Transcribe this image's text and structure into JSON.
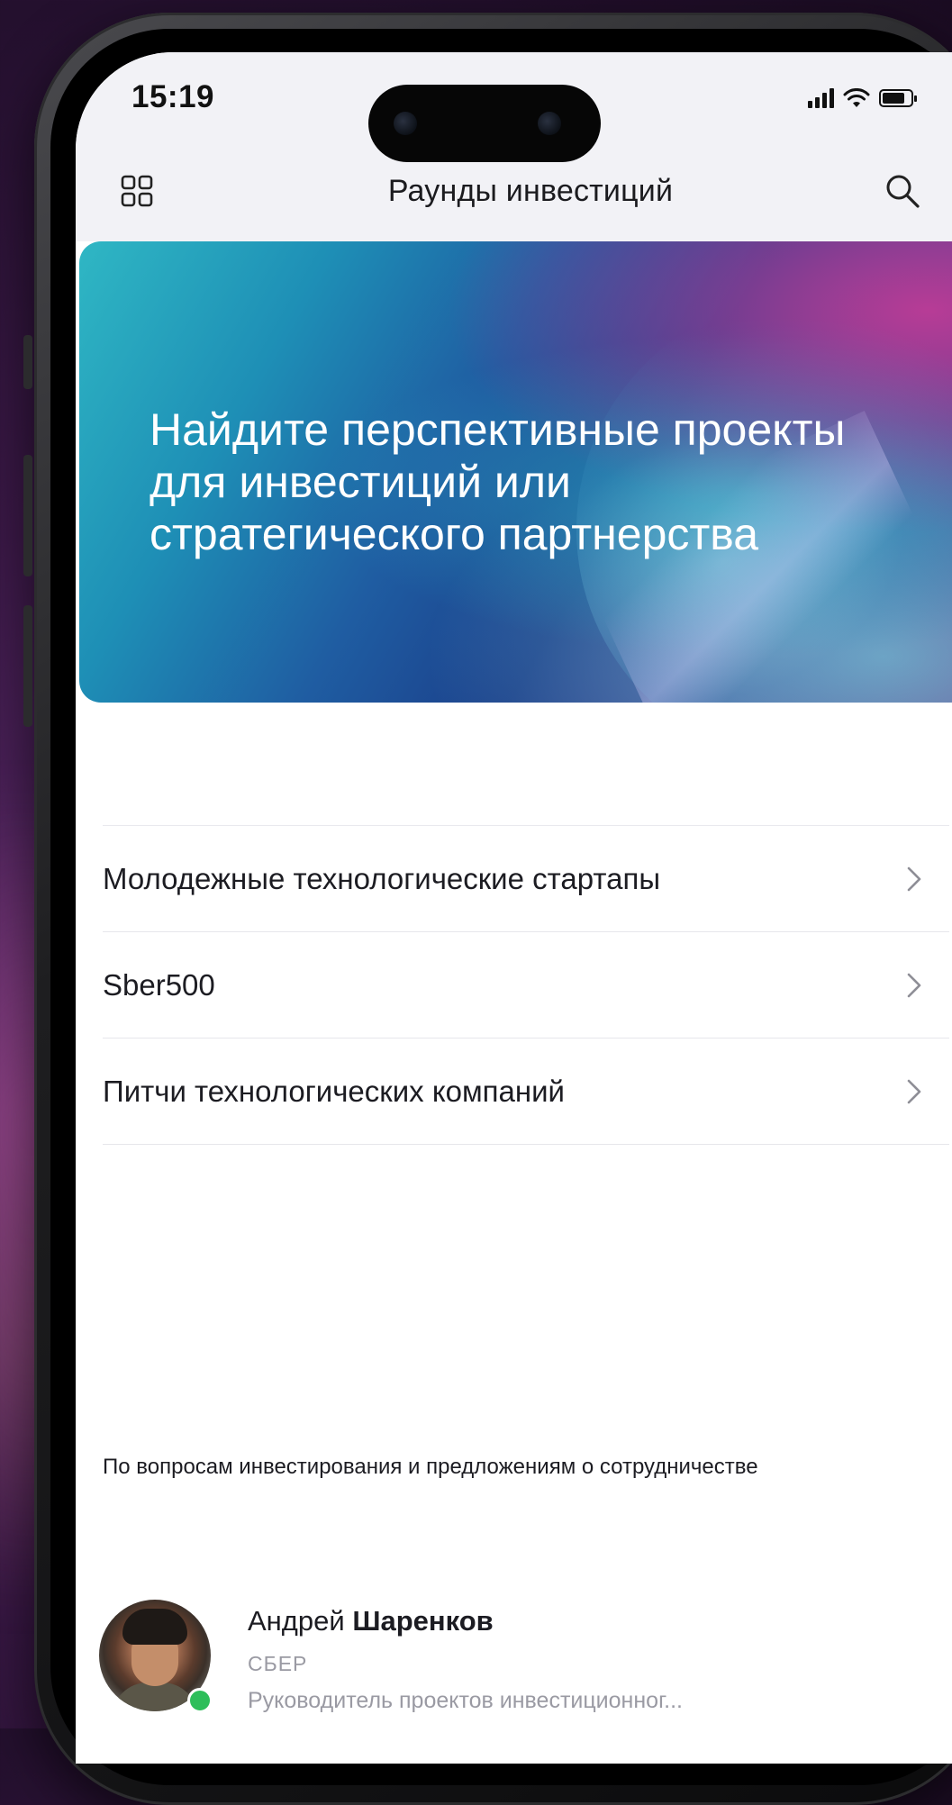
{
  "status_bar": {
    "time": "15:19"
  },
  "nav": {
    "title": "Раунды инвестиций",
    "grid_icon": "grid-icon",
    "search_icon": "search-icon"
  },
  "banner": {
    "headline": "Найдите перспективные проекты для инвестиций или стратегического партнерства"
  },
  "rounds": [
    {
      "label": "Молодежные технологические стартапы"
    },
    {
      "label": "Sber500"
    },
    {
      "label": "Питчи технологических компаний"
    }
  ],
  "contact": {
    "caption": "По вопросам инвестирования и предложениям о сотрудничестве",
    "first_name": "Андрей",
    "last_name": "Шаренков",
    "company": "СБЕР",
    "role": "Руководитель проектов инвестиционног...",
    "status_color": "#2dbe5a"
  },
  "colors": {
    "banner_start": "#2fb7c4",
    "banner_end": "#5f2f85",
    "header_bg": "#f2f2f6"
  }
}
